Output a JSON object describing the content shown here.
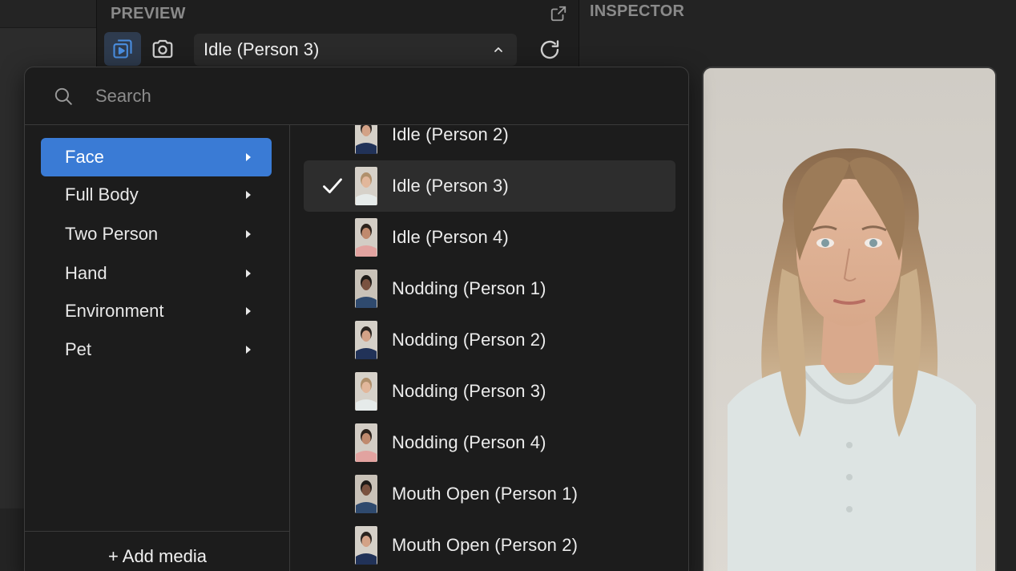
{
  "panels": {
    "preview_title": "PREVIEW",
    "inspector_title": "INSPECTOR"
  },
  "toolbar": {
    "selected_preset": "Idle (Person 3)",
    "icons": [
      "play-stack-icon",
      "camera-icon",
      "chevron-up-icon",
      "refresh-icon",
      "external-link-icon"
    ]
  },
  "dropdown": {
    "search_placeholder": "Search",
    "categories": [
      {
        "label": "Face",
        "selected": true
      },
      {
        "label": "Full Body",
        "selected": false
      },
      {
        "label": "Two Person",
        "selected": false
      },
      {
        "label": "Hand",
        "selected": false
      },
      {
        "label": "Environment",
        "selected": false
      },
      {
        "label": "Pet",
        "selected": false
      }
    ],
    "add_media_label": "+ Add media",
    "items": [
      {
        "label": "Idle (Person 2)",
        "selected": false,
        "person": 2
      },
      {
        "label": "Idle (Person 3)",
        "selected": true,
        "person": 3
      },
      {
        "label": "Idle (Person 4)",
        "selected": false,
        "person": 4
      },
      {
        "label": "Nodding (Person 1)",
        "selected": false,
        "person": 1
      },
      {
        "label": "Nodding (Person 2)",
        "selected": false,
        "person": 2
      },
      {
        "label": "Nodding (Person 3)",
        "selected": false,
        "person": 3
      },
      {
        "label": "Nodding (Person 4)",
        "selected": false,
        "person": 4
      },
      {
        "label": "Mouth Open (Person 1)",
        "selected": false,
        "person": 1
      },
      {
        "label": "Mouth Open (Person 2)",
        "selected": false,
        "person": 2
      }
    ]
  },
  "colors": {
    "accent": "#3a7bd5",
    "panel": "#1c1c1c",
    "selected_row": "#2d2d2d"
  }
}
